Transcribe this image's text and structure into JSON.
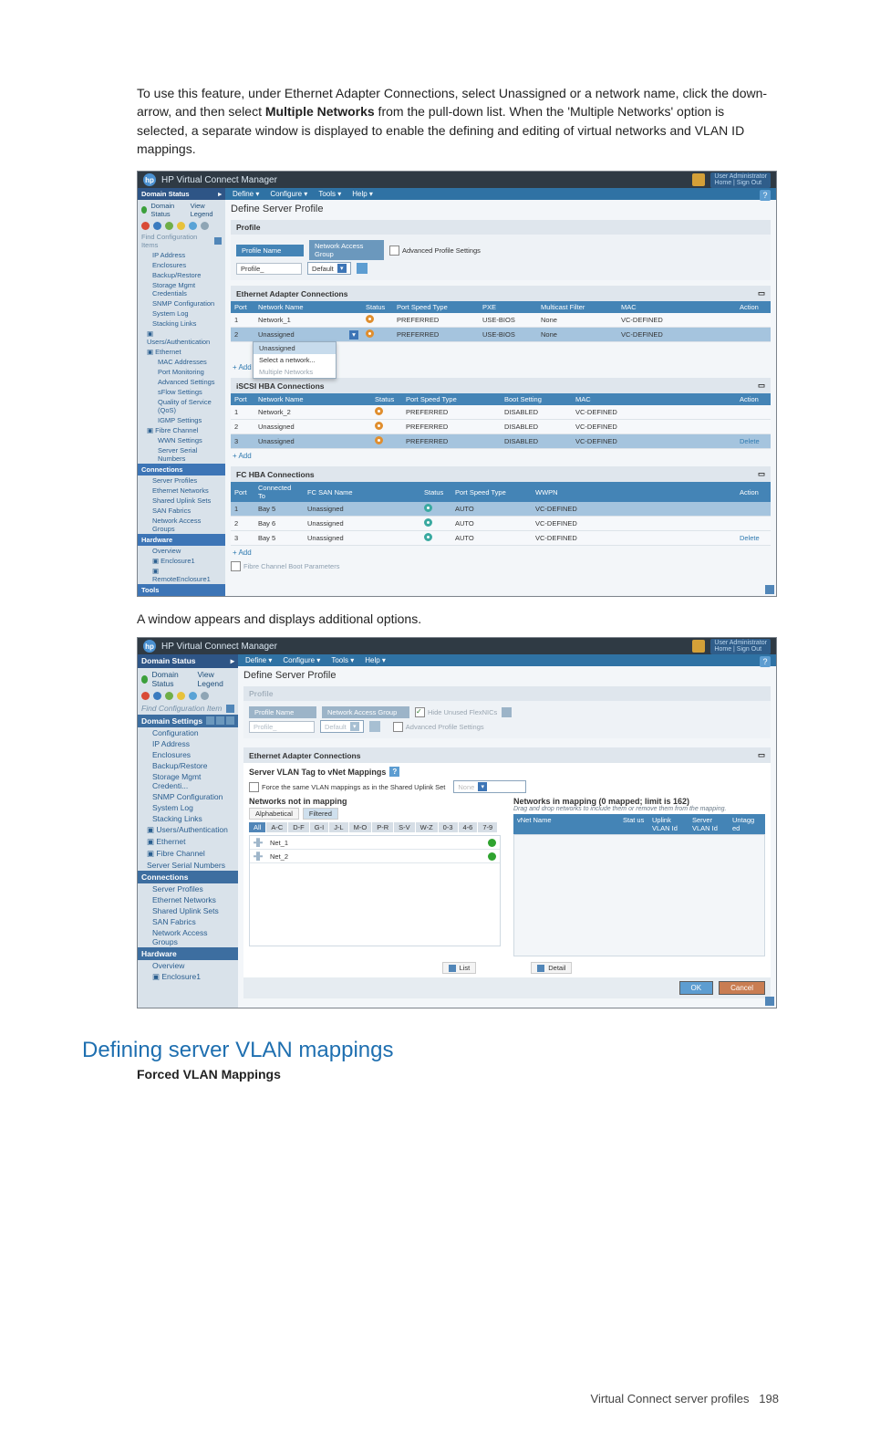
{
  "doc": {
    "intro_pre": "To use this feature, under Ethernet Adapter Connections, select Unassigned or a network name, click the down-arrow, and then select ",
    "intro_bold": "Multiple Networks",
    "intro_post": " from the pull-down list. When the 'Multiple Networks' option is selected, a separate window is displayed to enable the defining and editing of virtual networks and VLAN ID mappings.",
    "caption": "A window appears and displays additional options.",
    "section_heading": "Defining server VLAN mappings",
    "subheading": "Forced VLAN Mappings",
    "footer_left": "Virtual Connect server profiles",
    "footer_page": "198"
  },
  "app": {
    "title": "HP Virtual Connect Manager",
    "menu": [
      "Define ▾",
      "Configure ▾",
      "Tools ▾",
      "Help ▾"
    ],
    "user_lines": [
      "User  Administrator",
      "Home | Sign Out"
    ],
    "page_title": "Define Server Profile"
  },
  "sidebar1": {
    "head": "Domain Status",
    "sub_items": [
      "Domain Status",
      "View Legend"
    ],
    "status_colors": [
      "#d94b37",
      "#3a7bbf",
      "#6fae48",
      "#e7c23c",
      "#5aa3d6",
      "#8ea5b5"
    ],
    "find": "Find Configuration Items",
    "links": [
      "IP Address",
      "Enclosures",
      "Backup/Restore",
      "Storage Mgmt Credentials",
      "SNMP Configuration",
      "System Log",
      "Stacking Links"
    ],
    "sections": [
      {
        "key": "users",
        "label": "Users/Authentication",
        "open": true
      },
      {
        "key": "eth",
        "label": "Ethernet",
        "open": true,
        "children": [
          "MAC Addresses",
          "Port Monitoring",
          "Advanced Settings",
          "sFlow Settings",
          "Quality of Service (QoS)",
          "IGMP Settings"
        ]
      },
      {
        "key": "fc",
        "label": "Fibre Channel",
        "open": true,
        "children": [
          "WWN Settings",
          "Server Serial Numbers"
        ]
      }
    ],
    "connections_head": "Connections",
    "connections": [
      "Server Profiles",
      "Ethernet Networks",
      "Shared Uplink Sets",
      "SAN Fabrics",
      "Network Access Groups"
    ],
    "hardware_head": "Hardware",
    "hardware": [
      "Overview",
      "Enclosure1",
      "RemoteEnclosure1"
    ],
    "tools_head": "Tools"
  },
  "sidebar2": {
    "head": "Domain Status",
    "sub_items": [
      "Domain Status",
      "View Legend"
    ],
    "find": "Find Configuration Item",
    "settings_head": "Domain Settings",
    "links": [
      "Configuration",
      "IP Address",
      "Enclosures",
      "Backup/Restore",
      "Storage Mgmt Credenti...",
      "SNMP Configuration",
      "System Log",
      "Stacking Links"
    ],
    "top_sections": [
      "Users/Authentication",
      "Ethernet",
      "Fibre Channel",
      "Server Serial Numbers"
    ],
    "connections_head": "Connections",
    "connections": [
      "Server Profiles",
      "Ethernet Networks",
      "Shared Uplink Sets",
      "SAN Fabrics",
      "Network Access Groups"
    ],
    "hardware_head": "Hardware",
    "hardware": [
      "Overview",
      "Enclosure1"
    ]
  },
  "profile_panel": {
    "title": "Profile",
    "label": "Profile Name",
    "value": "Profile_",
    "accessgroup": "Network Access Group",
    "default": "Default",
    "adv": "Advanced Profile Settings"
  },
  "eth_panel": {
    "title": "Ethernet Adapter Connections",
    "cols": [
      "Port",
      "Network Name",
      "Status",
      "Port Speed Type",
      "PXE",
      "Multicast Filter",
      "MAC",
      "Action"
    ],
    "rows": [
      {
        "port": "1",
        "name": "Network_1",
        "status": "orange",
        "speed": "PREFERRED",
        "pxe": "USE-BIOS",
        "mcast": "None",
        "mac": "VC-DEFINED"
      },
      {
        "port": "2",
        "name": "Unassigned",
        "status": "orange",
        "speed": "PREFERRED",
        "pxe": "USE-BIOS",
        "mcast": "None",
        "mac": "VC-DEFINED",
        "open_menu": true
      }
    ],
    "menu": [
      "Unassigned",
      "Select a network..."
    ],
    "menu_hint": "Multiple Networks",
    "add": "+ Add"
  },
  "iscsi_panel": {
    "title": "iSCSI HBA Connections",
    "cols": [
      "Port",
      "Network Name",
      "Status",
      "Port Speed Type",
      "Boot Setting",
      "MAC",
      "Action"
    ],
    "rows": [
      {
        "port": "1",
        "name": "Network_2",
        "status": "orange",
        "speed": "PREFERRED",
        "boot": "DISABLED",
        "mac": "VC-DEFINED"
      },
      {
        "port": "2",
        "name": "Unassigned",
        "status": "orange",
        "speed": "PREFERRED",
        "boot": "DISABLED",
        "mac": "VC-DEFINED"
      },
      {
        "port": "3",
        "name": "Unassigned",
        "status": "orange",
        "speed": "PREFERRED",
        "boot": "DISABLED",
        "mac": "VC-DEFINED",
        "hl": true,
        "action": "Delete"
      }
    ],
    "add": "+ Add"
  },
  "fc_panel": {
    "title": "FC HBA Connections",
    "cols": [
      "Port",
      "Connected To",
      "FC SAN Name",
      "Status",
      "Port Speed Type",
      "WWPN",
      "Action"
    ],
    "rows": [
      {
        "port": "1",
        "bay": "Bay 5",
        "name": "Unassigned",
        "status": "teal",
        "speed": "AUTO",
        "wwpn": "VC-DEFINED",
        "hl": true
      },
      {
        "port": "2",
        "bay": "Bay 6",
        "name": "Unassigned",
        "status": "teal",
        "speed": "AUTO",
        "wwpn": "VC-DEFINED"
      },
      {
        "port": "3",
        "bay": "Bay 5",
        "name": "Unassigned",
        "status": "teal",
        "speed": "AUTO",
        "wwpn": "VC-DEFINED",
        "action": "Delete"
      }
    ],
    "add": "+ Add",
    "boot": "Fibre Channel Boot Parameters"
  },
  "profile_panel2": {
    "title": "Profile",
    "label": "Profile Name",
    "value": "Profile_",
    "accessgroup": "Network Access Group",
    "default": "Default",
    "hide": "Hide Unused FlexNICs",
    "adv": "Advanced Profile Settings"
  },
  "mapping": {
    "title": "Ethernet Adapter Connections",
    "subhead": "Server VLAN Tag to vNet Mappings",
    "force": "Force the same VLAN mappings as in the Shared Uplink Set",
    "select_placeholder": "None",
    "left_title": "Networks not in mapping",
    "right_title": "Networks in mapping (0 mapped; limit is 162)",
    "right_hint": "Drag and drop networks to include them or remove them from the mapping.",
    "tabs": [
      "Alphabetical",
      "Filtered"
    ],
    "alpha": [
      "All",
      "A-C",
      "D-F",
      "G-I",
      "J-L",
      "M-O",
      "P-R",
      "S-V",
      "W-Z",
      "0-3",
      "4-6",
      "7-9"
    ],
    "right_cols": [
      "vNet Name",
      "Stat us",
      "Uplink VLAN Id",
      "Server VLAN Id",
      "Untagg ed"
    ],
    "nets": [
      "Net_1",
      "Net_2"
    ],
    "list_btn": "List",
    "detail_btn": "Detail",
    "ok": "OK",
    "cancel": "Cancel"
  }
}
